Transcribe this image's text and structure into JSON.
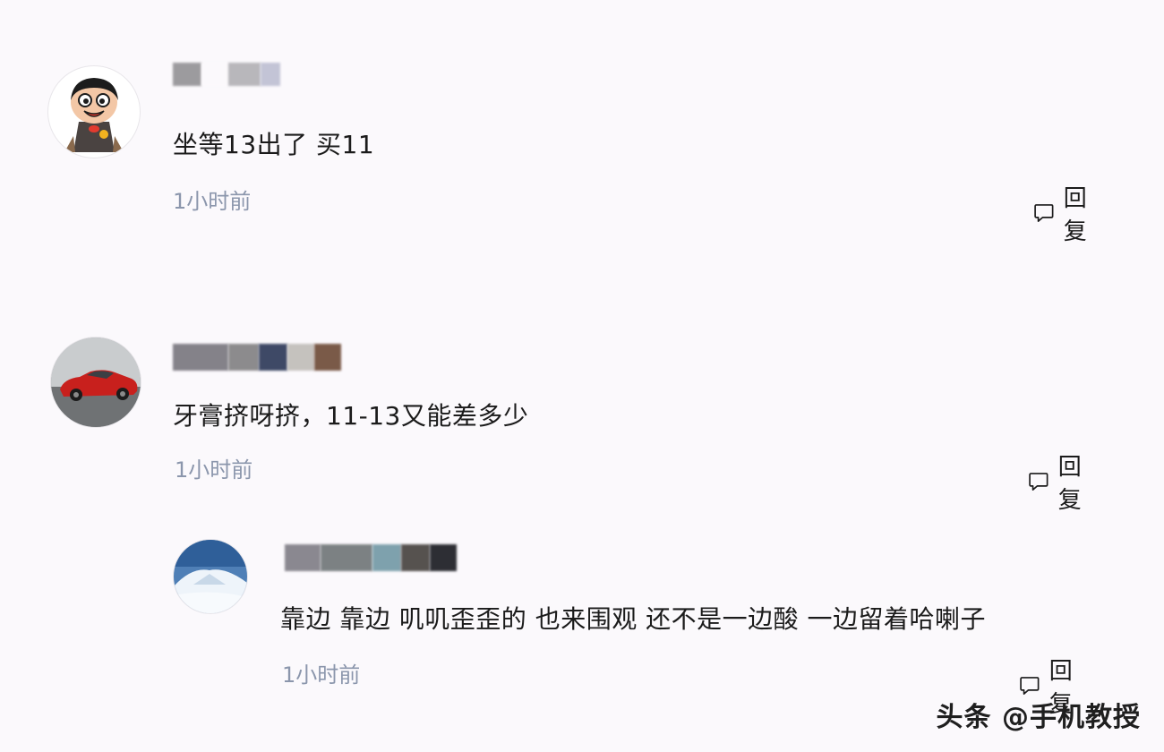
{
  "comments": [
    {
      "content": "坐等13出了 买11",
      "time": "1小时前",
      "reply_label": "回复",
      "avatar_icon": "cartoon-boy-avatar"
    },
    {
      "content": "牙膏挤呀挤，11-13又能差多少",
      "time": "1小时前",
      "reply_label": "回复",
      "avatar_icon": "red-sports-car-avatar"
    },
    {
      "content": "靠边 靠边 叽叽歪歪的 也来围观 还不是一边酸 一边留着哈喇子",
      "time": "1小时前",
      "reply_label": "回复",
      "avatar_icon": "snowy-roof-avatar"
    }
  ],
  "watermark": "头条 @手机教授",
  "colors": {
    "background": "#fbf9fc",
    "time_text": "#8b96ac"
  }
}
